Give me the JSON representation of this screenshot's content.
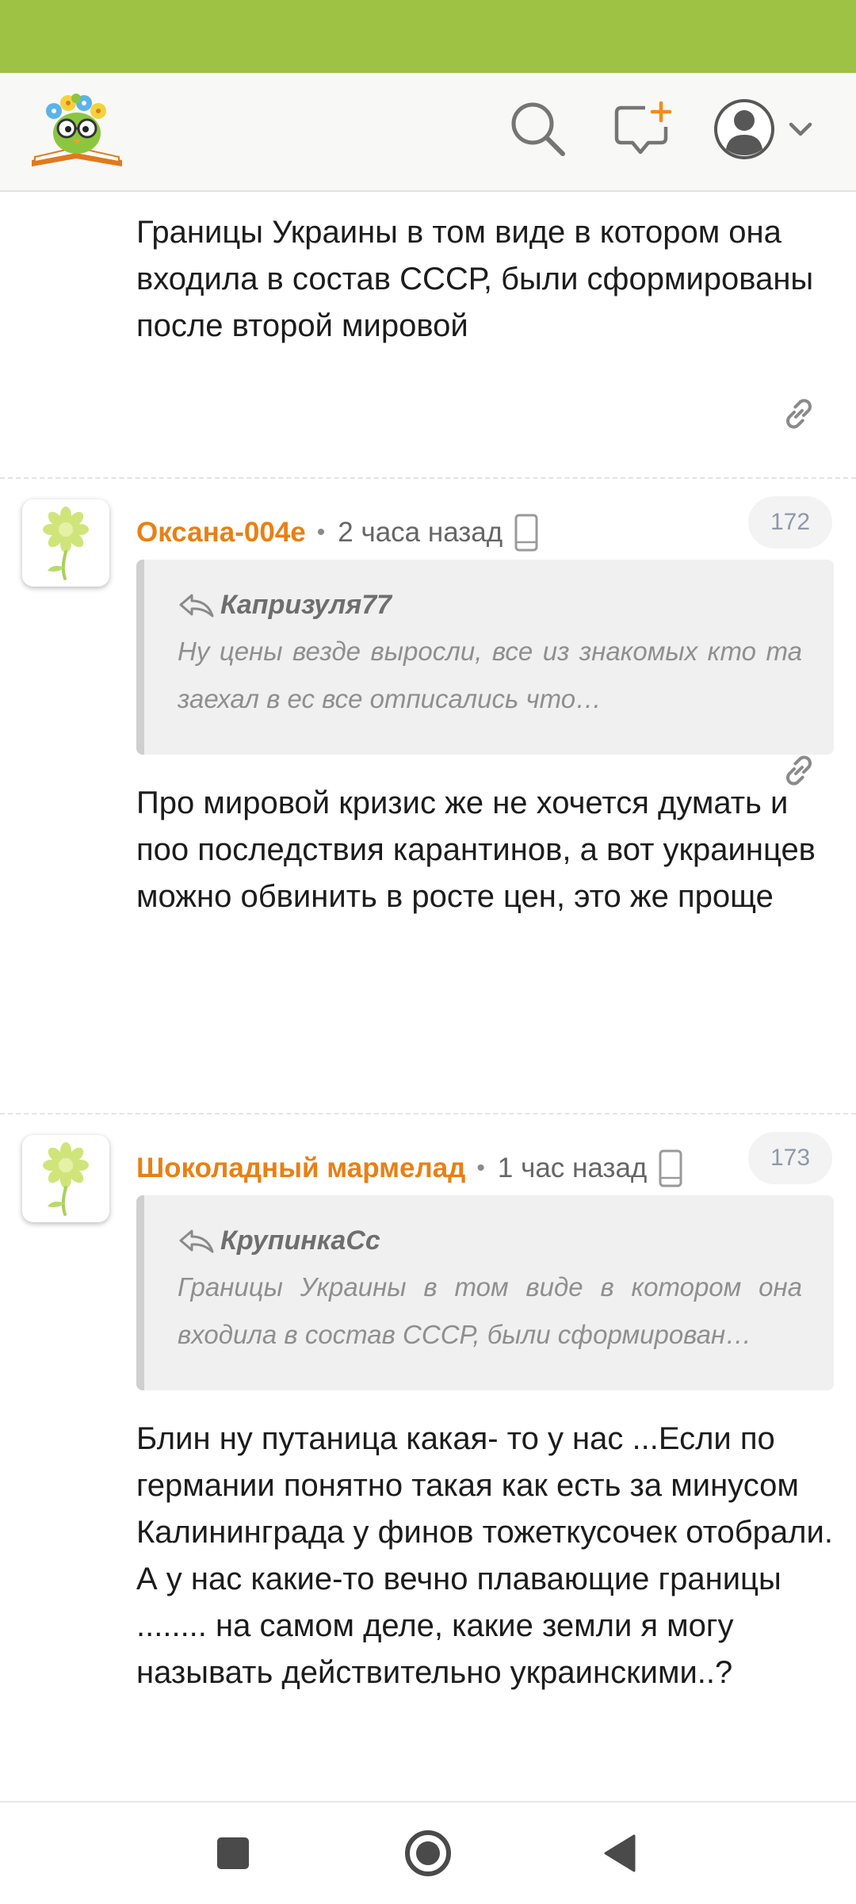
{
  "colors": {
    "status_bar": "#9dc244",
    "author": "#e88014",
    "badge_text": "#8f98a8",
    "quote_bg": "#f0f0f0"
  },
  "header": {
    "logo_icon": "owl-book-logo",
    "search_icon": "search-icon",
    "new_topic_icon": "chat-plus-icon",
    "profile_icon": "user-avatar-icon",
    "dropdown_icon": "chevron-down-icon"
  },
  "continued_comment": {
    "text": "Границы Украины в том виде в котором она входила в состав СССР, были сформированы после второй мировой"
  },
  "comments": [
    {
      "author": "Оксана-004е",
      "separator": "•",
      "time": "2 часа назад",
      "device_icon": "mobile-phone-icon",
      "number": "172",
      "quote": {
        "author": "Капризуля77",
        "text": "Ну цены везде выросли, все из знакомых кто та заехал в ес все отписались что…"
      },
      "text": "Про мировой кризис же не хочется думать и поо последствия карантинов, а вот украинцев можно обвинить в росте цен, это же проще"
    },
    {
      "author": "Шоколадный мармелад",
      "separator": "•",
      "time": "1 час назад",
      "device_icon": "mobile-phone-icon",
      "number": "173",
      "quote": {
        "author": "КрупинкаСс",
        "text": "Границы Украины в том виде в котором она входила в состав СССР, были сформирован…"
      },
      "text": "Блин ну путаница какая- то у нас ...Если по германии понятно такая как есть за минусом Калининграда у финов тожеткусочек отобрали. А у нас какие-то вечно плавающие границы ........ на самом деле, какие земли я могу называть действительно украинскими..?"
    }
  ],
  "nav": {
    "recents_icon": "square-icon",
    "home_icon": "circle-home-icon",
    "back_icon": "back-triangle-icon"
  }
}
